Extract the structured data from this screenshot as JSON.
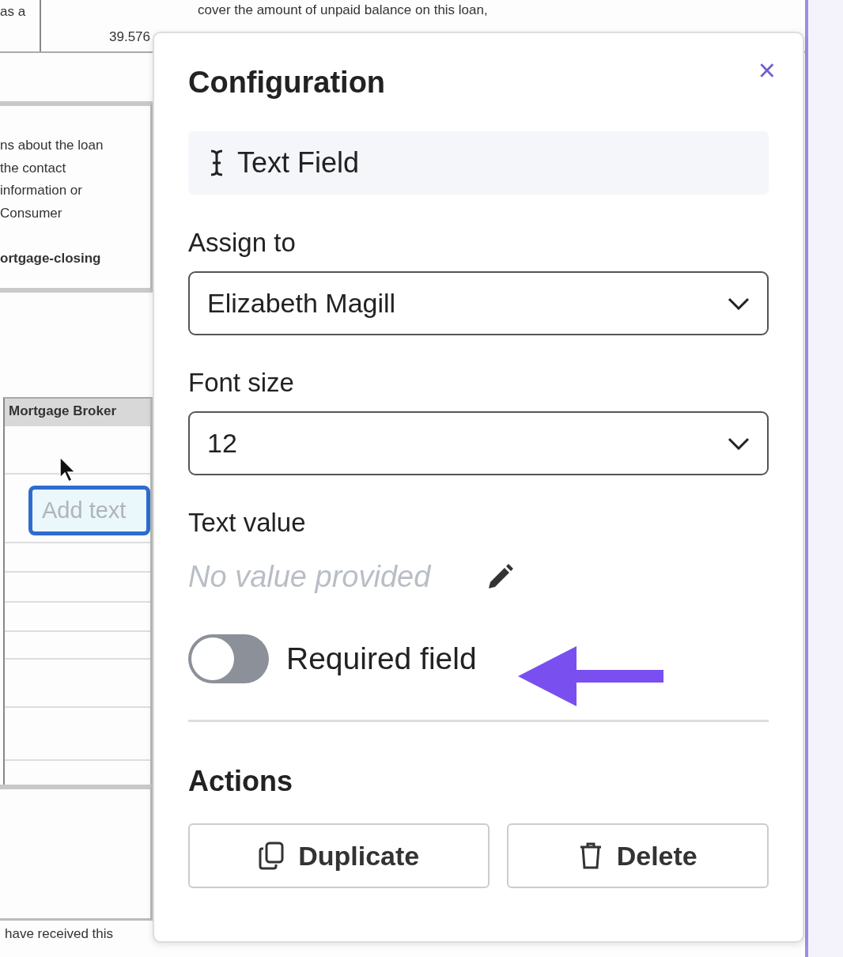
{
  "document": {
    "rate_label": "as a",
    "rate": "39.576",
    "notice_lines": [
      "cover the amount of unpaid balance on this loan,"
    ],
    "contact_lines": [
      "ns about the loan",
      "the contact",
      "information or",
      "Consumer"
    ],
    "contact_link": "ortgage-closing",
    "table_header": "Mortgage Broker",
    "text_field": {
      "placeholder": "Add text",
      "selected": true
    },
    "footer": "have received this"
  },
  "panel": {
    "title": "Configuration",
    "close": "×",
    "field_type": "Text Field",
    "assign_label": "Assign to",
    "assignee": "Elizabeth Magill",
    "font_size_label": "Font size",
    "font_size": "12",
    "text_value_label": "Text value",
    "text_value_placeholder": "No value provided",
    "required": {
      "label": "Required field",
      "on": false
    },
    "actions_title": "Actions",
    "actions": [
      {
        "kind": "duplicate",
        "label": "Duplicate"
      },
      {
        "kind": "delete",
        "label": "Delete"
      }
    ]
  }
}
